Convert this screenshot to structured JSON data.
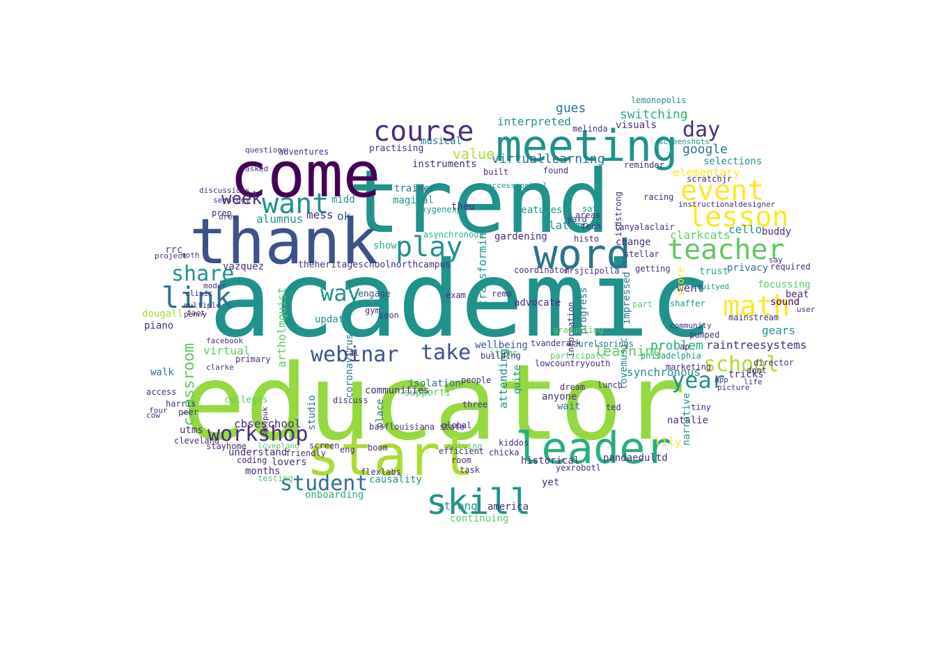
{
  "word_cloud": {
    "shape": "cloud",
    "background": "#ffffff",
    "palette": {
      "v1": "#440154",
      "v2": "#472d7b",
      "v3": "#3b528b",
      "v4": "#2c728e",
      "v5": "#21918c",
      "v6": "#28ae80",
      "v7": "#5ec962",
      "v8": "#addc30",
      "v9": "#fde725",
      "g1": "#95d840",
      "g2": "#1f9e89",
      "g3": "#31688e"
    },
    "words": [
      {
        "text": "academic",
        "color": "#21918c"
      },
      {
        "text": "educator",
        "color": "#95d840"
      },
      {
        "text": "trend",
        "color": "#21918c"
      },
      {
        "text": "come",
        "color": "#440154"
      },
      {
        "text": "thank",
        "color": "#3b528b"
      },
      {
        "text": "start",
        "color": "#addc30"
      },
      {
        "text": "meeting",
        "color": "#21918c"
      },
      {
        "text": "leader",
        "color": "#28ae80"
      },
      {
        "text": "course",
        "color": "#472d7b"
      },
      {
        "text": "word",
        "color": "#2c728e"
      },
      {
        "text": "lesson",
        "color": "#fde725"
      },
      {
        "text": "event",
        "color": "#fde725"
      },
      {
        "text": "teacher",
        "color": "#5ec962"
      },
      {
        "text": "math",
        "color": "#fde725"
      },
      {
        "text": "skill",
        "color": "#21918c"
      },
      {
        "text": "want",
        "color": "#21918c"
      },
      {
        "text": "play",
        "color": "#21918c"
      },
      {
        "text": "link",
        "color": "#2c728e"
      },
      {
        "text": "webinar",
        "color": "#3b528b"
      },
      {
        "text": "take",
        "color": "#3b528b"
      },
      {
        "text": "workshop",
        "color": "#472d7b"
      },
      {
        "text": "student",
        "color": "#2c728e"
      },
      {
        "text": "school",
        "color": "#addc30"
      },
      {
        "text": "year",
        "color": "#21918c"
      },
      {
        "text": "share",
        "color": "#21918c"
      },
      {
        "text": "way",
        "color": "#21918c"
      },
      {
        "text": "day",
        "color": "#472d7b"
      },
      {
        "text": "week",
        "color": "#472d7b"
      },
      {
        "text": "classroom",
        "color": "#5ec962"
      },
      {
        "text": "virtuallearning",
        "color": "#2c728e"
      },
      {
        "text": "switching",
        "color": "#28ae80"
      },
      {
        "text": "google",
        "color": "#2c728e"
      },
      {
        "text": "elementary",
        "color": "#fde725"
      },
      {
        "text": "interpreted",
        "color": "#21918c"
      },
      {
        "text": "gues",
        "color": "#2c728e"
      },
      {
        "text": "visuals",
        "color": "#472d7b"
      },
      {
        "text": "selections",
        "color": "#21918c"
      },
      {
        "text": "value",
        "color": "#addc30"
      },
      {
        "text": "musical",
        "color": "#2c728e"
      },
      {
        "text": "practising",
        "color": "#472d7b"
      },
      {
        "text": "instruments",
        "color": "#472d7b"
      },
      {
        "text": "magical",
        "color": "#21918c"
      },
      {
        "text": "trainer",
        "color": "#2c728e"
      },
      {
        "text": "oxygenexp",
        "color": "#21918c"
      },
      {
        "text": "theu",
        "color": "#472d7b"
      },
      {
        "text": "mess",
        "color": "#472d7b"
      },
      {
        "text": "ok",
        "color": "#3b528b"
      },
      {
        "text": "midd",
        "color": "#21918c"
      },
      {
        "text": "alumnus",
        "color": "#21918c"
      },
      {
        "text": "adventures",
        "color": "#472d7b"
      },
      {
        "text": "features",
        "color": "#21918c"
      },
      {
        "text": "gardening",
        "color": "#472d7b"
      },
      {
        "text": "latimore",
        "color": "#21918c"
      },
      {
        "text": "transforming",
        "color": "#21918c"
      },
      {
        "text": "asynchronous",
        "color": "#28ae80"
      },
      {
        "text": "cello",
        "color": "#21918c"
      },
      {
        "text": "clarkcats",
        "color": "#5ec962"
      },
      {
        "text": "change",
        "color": "#472d7b"
      },
      {
        "text": "buddy",
        "color": "#472d7b"
      },
      {
        "text": "trust",
        "color": "#28ae80"
      },
      {
        "text": "privacy",
        "color": "#2c728e"
      },
      {
        "text": "focussing",
        "color": "#5ec962"
      },
      {
        "text": "beat",
        "color": "#472d7b"
      },
      {
        "text": "sound",
        "color": "#440154"
      },
      {
        "text": "gears",
        "color": "#21918c"
      },
      {
        "text": "tricks",
        "color": "#472d7b"
      },
      {
        "text": "raintreesystems",
        "color": "#472d7b"
      },
      {
        "text": "problem",
        "color": "#28ae80"
      },
      {
        "text": "philadelphia",
        "color": "#21918c"
      },
      {
        "text": "learning",
        "color": "#5ec962"
      },
      {
        "text": "lovemusic",
        "color": "#21918c"
      },
      {
        "text": "synchronous",
        "color": "#21918c"
      },
      {
        "text": "natalie",
        "color": "#472d7b"
      },
      {
        "text": "narrative",
        "color": "#21918c"
      },
      {
        "text": "lily",
        "color": "#fde725"
      },
      {
        "text": "impressed",
        "color": "#2c728e"
      },
      {
        "text": "went",
        "color": "#472d7b"
      },
      {
        "text": "score",
        "color": "#fde725"
      },
      {
        "text": "shaffer",
        "color": "#21918c"
      },
      {
        "text": "progress",
        "color": "#2c728e"
      },
      {
        "text": "advocate",
        "color": "#472d7b"
      },
      {
        "text": "wellbeing",
        "color": "#3b528b"
      },
      {
        "text": "items",
        "color": "#5ec962"
      },
      {
        "text": "attending",
        "color": "#21918c"
      },
      {
        "text": "quite",
        "color": "#21918c"
      },
      {
        "text": "anyone",
        "color": "#472d7b"
      },
      {
        "text": "wait",
        "color": "#2c728e"
      },
      {
        "text": "historical",
        "color": "#472d7b"
      },
      {
        "text": "yet",
        "color": "#472d7b"
      },
      {
        "text": "america",
        "color": "#472d7b"
      },
      {
        "text": "strong",
        "color": "#21918c"
      },
      {
        "text": "continuing",
        "color": "#5ec962"
      },
      {
        "text": "causality",
        "color": "#21918c"
      },
      {
        "text": "onboarding",
        "color": "#28ae80"
      },
      {
        "text": "isolation",
        "color": "#2c728e"
      },
      {
        "text": "supporti",
        "color": "#5ec962"
      },
      {
        "text": "studio",
        "color": "#2c728e"
      },
      {
        "text": "coronavirus",
        "color": "#2c728e"
      },
      {
        "text": "place",
        "color": "#2c728e"
      },
      {
        "text": "communities",
        "color": "#472d7b"
      },
      {
        "text": "basflouisiana state",
        "color": "#472d7b"
      },
      {
        "text": "update",
        "color": "#21918c"
      },
      {
        "text": "engage",
        "color": "#3b528b"
      },
      {
        "text": "show",
        "color": "#28ae80"
      },
      {
        "text": "theheritageschoolnorthcampus",
        "color": "#472d7b"
      },
      {
        "text": "artholmquist",
        "color": "#5ec962"
      },
      {
        "text": "vazquez",
        "color": "#472d7b"
      },
      {
        "text": "virtual",
        "color": "#5ec962"
      },
      {
        "text": "dougall",
        "color": "#addc30"
      },
      {
        "text": "piano",
        "color": "#472d7b"
      },
      {
        "text": "walk",
        "color": "#2c728e"
      },
      {
        "text": "utms",
        "color": "#472d7b"
      },
      {
        "text": "cbseschool",
        "color": "#472d7b"
      },
      {
        "text": "understand",
        "color": "#472d7b"
      },
      {
        "text": "months",
        "color": "#472d7b"
      },
      {
        "text": "lovers",
        "color": "#472d7b"
      },
      {
        "text": "rrc",
        "color": "#3b528b"
      },
      {
        "text": "isdstrong",
        "color": "#472d7b"
      },
      {
        "text": "coordinator",
        "color": "#472d7b"
      },
      {
        "text": "mrsjcipolla",
        "color": "#472d7b"
      },
      {
        "text": "tanyalaclair",
        "color": "#472d7b"
      },
      {
        "text": "sat",
        "color": "#21918c"
      },
      {
        "text": "areas",
        "color": "#472d7b"
      },
      {
        "text": "tech",
        "color": "#472d7b"
      },
      {
        "text": "mainstream",
        "color": "#472d7b"
      },
      {
        "text": "equityed",
        "color": "#21918c"
      },
      {
        "text": "community",
        "color": "#472d7b"
      },
      {
        "text": "lemonopolis",
        "color": "#21918c"
      },
      {
        "text": "melinda",
        "color": "#472d7b"
      },
      {
        "text": "racing",
        "color": "#472d7b"
      },
      {
        "text": "scratchjr",
        "color": "#472d7b"
      },
      {
        "text": "screenshots",
        "color": "#21918c"
      },
      {
        "text": "instructionaldesigner",
        "color": "#472d7b"
      },
      {
        "text": "pandaedultd",
        "color": "#472d7b"
      },
      {
        "text": "information",
        "color": "#472d7b"
      },
      {
        "text": "lowcountryyouth",
        "color": "#472d7b"
      },
      {
        "text": "tvanderark",
        "color": "#472d7b"
      },
      {
        "text": "laurelsprings",
        "color": "#2c728e"
      },
      {
        "text": "harris",
        "color": "#472d7b"
      },
      {
        "text": "peer",
        "color": "#472d7b"
      },
      {
        "text": "access",
        "color": "#472d7b"
      },
      {
        "text": "cleveland",
        "color": "#472d7b"
      },
      {
        "text": "facebook",
        "color": "#472d7b"
      },
      {
        "text": "primary",
        "color": "#472d7b"
      },
      {
        "text": "friendly",
        "color": "#472d7b"
      },
      {
        "text": "eng",
        "color": "#472d7b"
      },
      {
        "text": "boom",
        "color": "#472d7b"
      },
      {
        "text": "flexlabs",
        "color": "#472d7b"
      },
      {
        "text": "room",
        "color": "#472d7b"
      },
      {
        "text": "global",
        "color": "#472d7b"
      },
      {
        "text": "exam",
        "color": "#472d7b"
      },
      {
        "text": "discuss",
        "color": "#472d7b"
      },
      {
        "text": "screen",
        "color": "#472d7b"
      },
      {
        "text": "people",
        "color": "#472d7b"
      },
      {
        "text": "three",
        "color": "#472d7b"
      },
      {
        "text": "solving",
        "color": "#5ec962"
      },
      {
        "text": "efficient",
        "color": "#472d7b"
      },
      {
        "text": "chicka",
        "color": "#472d7b"
      },
      {
        "text": "remo",
        "color": "#472d7b"
      },
      {
        "text": "found",
        "color": "#472d7b"
      },
      {
        "text": "built",
        "color": "#472d7b"
      },
      {
        "text": "accesscontrol",
        "color": "#21918c"
      },
      {
        "text": "reminder",
        "color": "#472d7b"
      },
      {
        "text": "required",
        "color": "#472d7b"
      },
      {
        "text": "dont",
        "color": "#472d7b"
      },
      {
        "text": "director",
        "color": "#472d7b"
      },
      {
        "text": "lunch",
        "color": "#472d7b"
      },
      {
        "text": "ted",
        "color": "#472d7b"
      },
      {
        "text": "dream",
        "color": "#472d7b"
      },
      {
        "text": "marketing",
        "color": "#472d7b"
      },
      {
        "text": "ap",
        "color": "#472d7b"
      },
      {
        "text": "tiny",
        "color": "#472d7b"
      },
      {
        "text": "user",
        "color": "#472d7b"
      },
      {
        "text": "say",
        "color": "#472d7b"
      },
      {
        "text": "app",
        "color": "#472d7b"
      },
      {
        "text": "picture",
        "color": "#472d7b"
      },
      {
        "text": "life",
        "color": "#472d7b"
      },
      {
        "text": "clarke",
        "color": "#472d7b"
      },
      {
        "text": "serology",
        "color": "#472d7b"
      },
      {
        "text": "discussions",
        "color": "#472d7b"
      },
      {
        "text": "questions",
        "color": "#472d7b"
      },
      {
        "text": "asked",
        "color": "#472d7b"
      },
      {
        "text": "project",
        "color": "#472d7b"
      },
      {
        "text": "moth",
        "color": "#472d7b"
      },
      {
        "text": "aelpuk",
        "color": "#472d7b"
      },
      {
        "text": "clinic",
        "color": "#472d7b"
      },
      {
        "text": "multiple",
        "color": "#472d7b"
      },
      {
        "text": "penny",
        "color": "#472d7b"
      },
      {
        "text": "fact",
        "color": "#472d7b"
      },
      {
        "text": "moder",
        "color": "#472d7b"
      },
      {
        "text": "four",
        "color": "#472d7b"
      },
      {
        "text": "cow",
        "color": "#472d7b"
      },
      {
        "text": "colleges",
        "color": "#5ec962"
      },
      {
        "text": "stayhome",
        "color": "#472d7b"
      },
      {
        "text": "coding",
        "color": "#472d7b"
      },
      {
        "text": "drew",
        "color": "#472d7b"
      },
      {
        "text": "prep",
        "color": "#472d7b"
      },
      {
        "text": "loveplano",
        "color": "#5ec962"
      },
      {
        "text": "cal",
        "color": "#472d7b"
      },
      {
        "text": "soon",
        "color": "#472d7b"
      },
      {
        "text": "gym",
        "color": "#472d7b"
      },
      {
        "text": "getting",
        "color": "#472d7b"
      },
      {
        "text": "stellar",
        "color": "#472d7b"
      },
      {
        "text": "part",
        "color": "#5ec962"
      },
      {
        "text": "pumped",
        "color": "#472d7b"
      },
      {
        "text": "building",
        "color": "#472d7b"
      },
      {
        "text": "yexrobotl",
        "color": "#472d7b"
      },
      {
        "text": "task",
        "color": "#472d7b"
      },
      {
        "text": "participate",
        "color": "#5ec962"
      },
      {
        "text": "yard",
        "color": "#472d7b"
      },
      {
        "text": "graduating",
        "color": "#5ec962"
      },
      {
        "text": "kiddos",
        "color": "#472d7b"
      },
      {
        "text": "histo",
        "color": "#472d7b"
      },
      {
        "text": "testing",
        "color": "#5ec962"
      }
    ]
  }
}
